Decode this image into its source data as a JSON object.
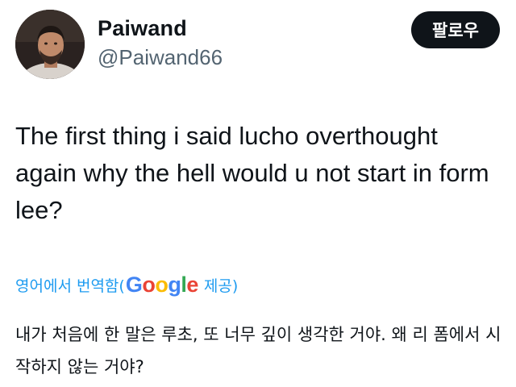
{
  "author": {
    "name": "Paiwand",
    "handle": "@Paiwand66"
  },
  "follow_button": {
    "label": "팔로우"
  },
  "tweet": {
    "text": "The first thing i said lucho overthought again why the hell would u not start in form lee?"
  },
  "translation": {
    "prefix": "영어에서 번역함(",
    "provider_logo_text": "Google",
    "suffix": "제공)",
    "translated_text": "내가 처음에 한 말은 루초, 또 너무 깊이 생각한 거야. 왜 리 폼에서 시작하지 않는 거야?"
  },
  "colors": {
    "link": "#1d9bf0",
    "button_bg": "#0f1419",
    "secondary_text": "#536471"
  }
}
